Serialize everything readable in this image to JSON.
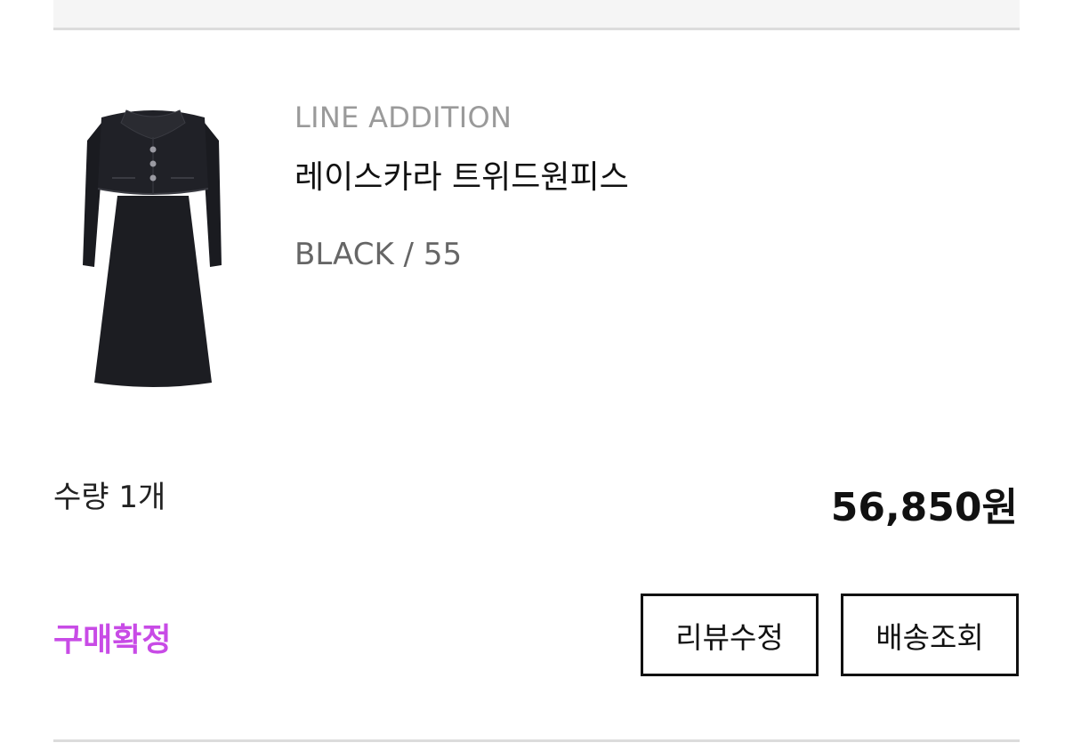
{
  "order_item": {
    "brand": "LINE ADDITION",
    "product_name": "레이스카라 트위드원피스",
    "option": "BLACK / 55",
    "quantity_text": "수량 1개",
    "price": "56,850원",
    "status": "구매확정"
  },
  "actions": {
    "review_label": "리뷰수정",
    "track_label": "배송조회"
  },
  "colors": {
    "status_accent": "#c84be6",
    "dress": "#1c1d22"
  },
  "icons": {
    "product_image": "dress-product-image"
  }
}
